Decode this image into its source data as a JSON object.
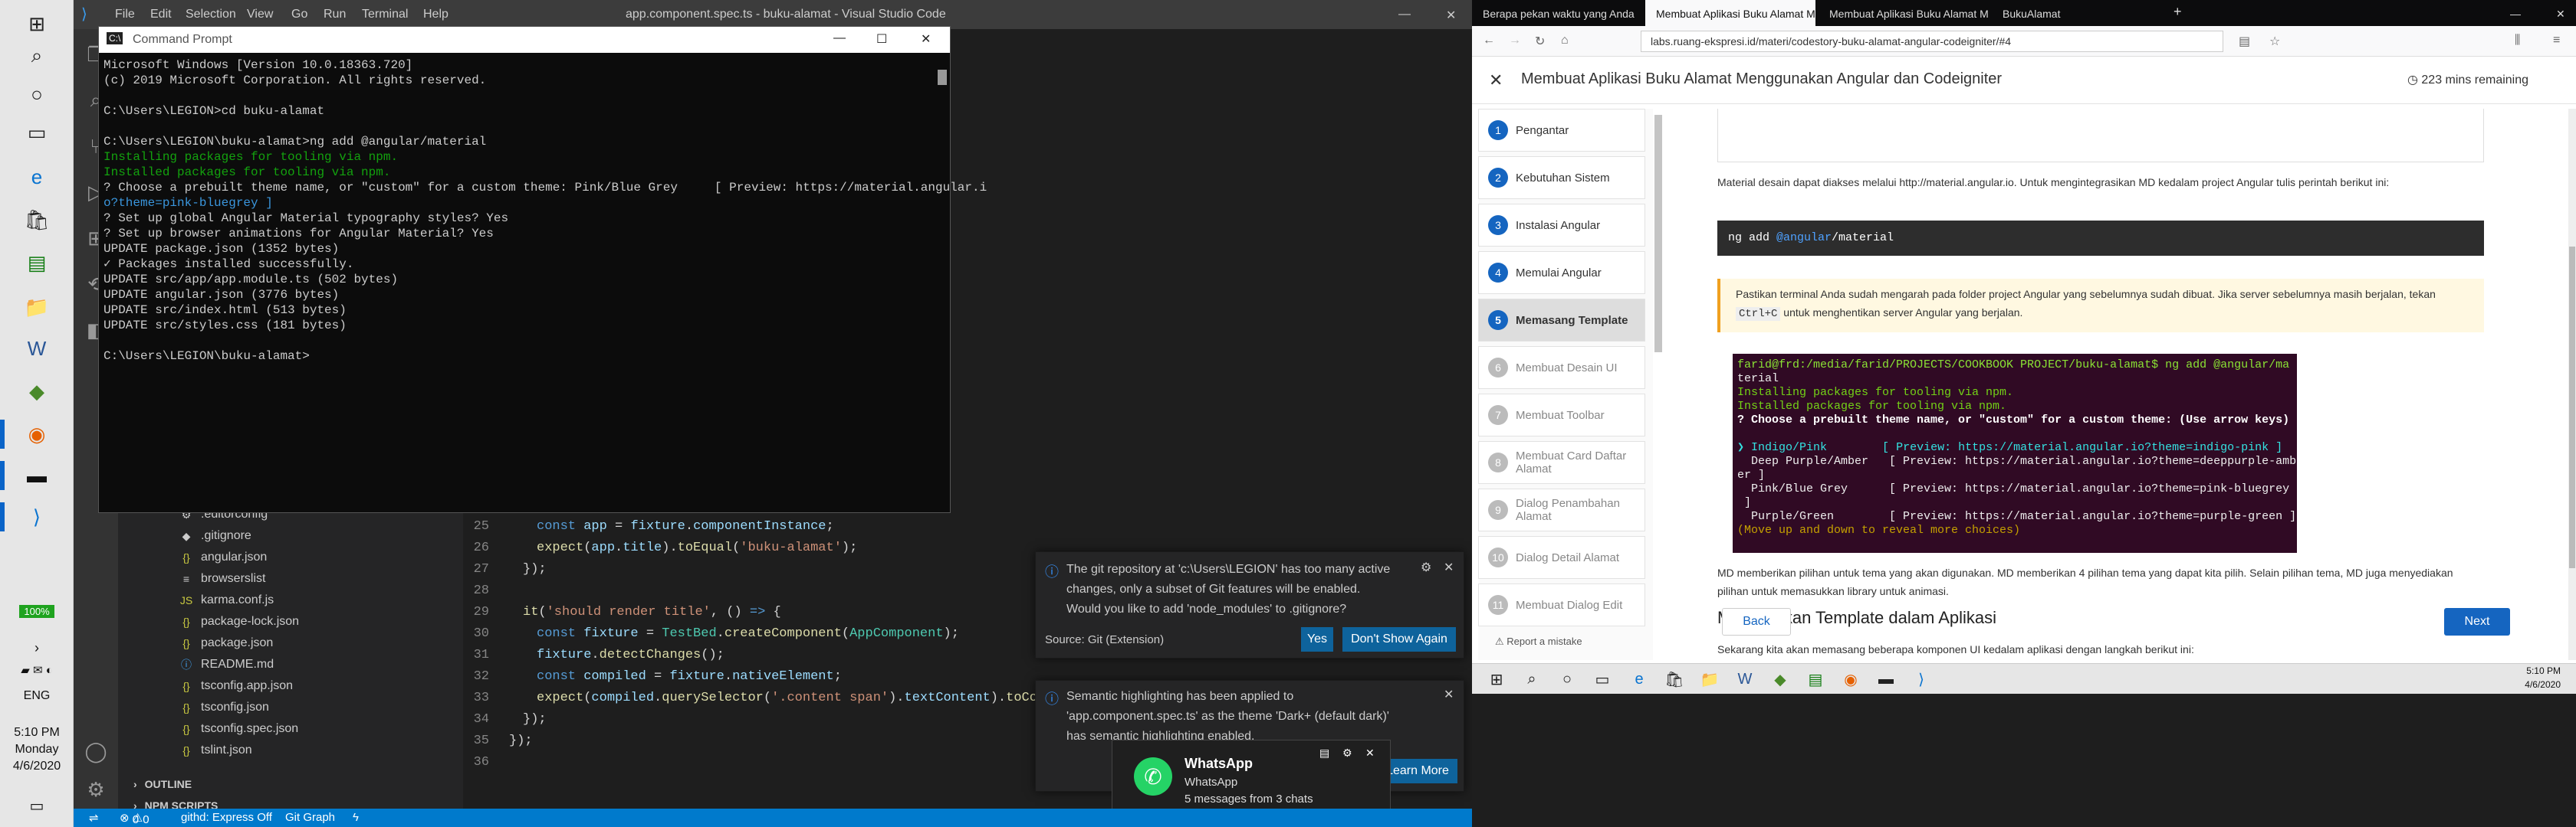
{
  "taskbar_left": {
    "battery": "100%",
    "lang": "ENG",
    "time": "5:10 PM",
    "day": "Monday",
    "date": "4/6/2020"
  },
  "vscode": {
    "menus": [
      "File",
      "Edit",
      "Selection",
      "View",
      "Go",
      "Run",
      "Terminal",
      "Help"
    ],
    "title": "app.component.spec.ts - buku-alamat - Visual Studio Code",
    "files": [
      ".editorconfig",
      ".gitignore",
      "angular.json",
      "browserslist",
      "karma.conf.js",
      "package-lock.json",
      "package.json",
      "README.md",
      "tsconfig.app.json",
      "tsconfig.json",
      "tsconfig.spec.json",
      "tslint.json"
    ],
    "outline": "OUTLINE",
    "npm": "NPM SCRIPTS",
    "code": [
      {
        "n": "25",
        "t": "const app = fixture.componentInstance;"
      },
      {
        "n": "26",
        "t": "expect(app.title).toEqual('buku-alamat');"
      },
      {
        "n": "27",
        "t": "});"
      },
      {
        "n": "28",
        "t": ""
      },
      {
        "n": "29",
        "t": "it('should render title', () => {"
      },
      {
        "n": "30",
        "t": "const fixture = TestBed.createComponent(AppComponent);"
      },
      {
        "n": "31",
        "t": "fixture.detectChanges();"
      },
      {
        "n": "32",
        "t": "const compiled = fixture.nativeElement;"
      },
      {
        "n": "33",
        "t": "expect(compiled.querySelector('.content span').textContent).toContain('buku-alamat app is running!');"
      },
      {
        "n": "34",
        "t": "});"
      },
      {
        "n": "35",
        "t": "});"
      },
      {
        "n": "36",
        "t": ""
      }
    ],
    "status": {
      "branch": "githd: Express Off",
      "graph": "Git Graph",
      "errors": "0",
      "warnings": "0"
    }
  },
  "cmd": {
    "title": "Command Prompt",
    "lines": [
      {
        "c": "",
        "t": "Microsoft Windows [Version 10.0.18363.720]"
      },
      {
        "c": "",
        "t": "(c) 2019 Microsoft Corporation. All rights reserved."
      },
      {
        "c": "",
        "t": ""
      },
      {
        "c": "",
        "t": "C:\\Users\\LEGION>cd buku-alamat"
      },
      {
        "c": "",
        "t": ""
      },
      {
        "c": "",
        "t": "C:\\Users\\LEGION\\buku-alamat>ng add @angular/material"
      },
      {
        "c": "g",
        "t": "Installing packages for tooling via npm."
      },
      {
        "c": "g",
        "t": "Installed packages for tooling via npm."
      },
      {
        "c": "",
        "t": "? Choose a prebuilt theme name, or \"custom\" for a custom theme: Pink/Blue Grey     [ Preview: https://material.angular.i"
      },
      {
        "c": "c",
        "t": "o?theme=pink-bluegrey ]"
      },
      {
        "c": "",
        "t": "? Set up global Angular Material typography styles? Yes"
      },
      {
        "c": "",
        "t": "? Set up browser animations for Angular Material? Yes"
      },
      {
        "c": "",
        "t": "UPDATE package.json (1352 bytes)"
      },
      {
        "c": "",
        "t": "✓ Packages installed successfully."
      },
      {
        "c": "",
        "t": "UPDATE src/app/app.module.ts (502 bytes)"
      },
      {
        "c": "",
        "t": "UPDATE angular.json (3776 bytes)"
      },
      {
        "c": "",
        "t": "UPDATE src/index.html (513 bytes)"
      },
      {
        "c": "",
        "t": "UPDATE src/styles.css (181 bytes)"
      },
      {
        "c": "",
        "t": ""
      },
      {
        "c": "",
        "t": "C:\\Users\\LEGION\\buku-alamat>"
      }
    ]
  },
  "notif_git": {
    "text": "The git repository at 'c:\\Users\\LEGION' has too many active changes, only a subset of Git features will be enabled. Would you like to add 'node_modules' to .gitignore?",
    "source": "Source: Git (Extension)",
    "yes": "Yes",
    "dont": "Don't Show Again"
  },
  "notif_sem": {
    "text": "Semantic highlighting has been applied to 'app.component.spec.ts' as the theme 'Dark+ (default dark)' has semantic highlighting enabled.",
    "learn": "Learn More"
  },
  "whatsapp": {
    "title": "WhatsApp",
    "sub": "WhatsApp",
    "msg": "5 messages from 3 chats"
  },
  "browser": {
    "tabs": [
      "Berapa pekan waktu yang Anda",
      "Membuat Aplikasi Buku Alamat M",
      "Membuat Aplikasi Buku Alamat M",
      "BukuAlamat"
    ],
    "url": "labs.ruang-ekspresi.id/materi/codestory-buku-alamat-angular-codeigniter/#4",
    "course_title": "Membuat Aplikasi Buku Alamat Menggunakan Angular dan Codeigniter",
    "time_left": "223 mins remaining",
    "steps": [
      {
        "n": "1",
        "label": "Pengantar"
      },
      {
        "n": "2",
        "label": "Kebutuhan Sistem"
      },
      {
        "n": "3",
        "label": "Instalasi Angular"
      },
      {
        "n": "4",
        "label": "Memulai Angular"
      },
      {
        "n": "5",
        "label": "Memasang Template"
      },
      {
        "n": "6",
        "label": "Membuat Desain UI"
      },
      {
        "n": "7",
        "label": "Membuat Toolbar"
      },
      {
        "n": "8",
        "label": "Membuat Card Daftar Alamat"
      },
      {
        "n": "9",
        "label": "Dialog Penambahan Alamat"
      },
      {
        "n": "10",
        "label": "Dialog Detail Alamat"
      },
      {
        "n": "11",
        "label": "Membuat Dialog Edit"
      }
    ],
    "report": "Report a mistake",
    "p1": "Material desain dapat diakses melalui http://material.angular.io. Untuk mengintegrasikan MD kedalam project Angular tulis perintah berikut ini:",
    "cmd1a": "ng add ",
    "cmd1b": "@angular",
    "cmd1c": "/material",
    "note_a": "Pastikan terminal Anda sudah mengarah pada folder project Angular yang sebelumnya sudah dibuat. Jika server sebelumnya masih berjalan, tekan ",
    "note_key": "Ctrl+C",
    "note_b": " untuk menghentikan server Angular yang berjalan.",
    "term": [
      {
        "c": "p",
        "t": "farid@frd:/media/farid/PROJECTS/COOKBOOK PROJECT/buku-alamat$ ng add @angular/ma"
      },
      {
        "c": "",
        "t": "terial"
      },
      {
        "c": "g",
        "t": "Installing packages for tooling via npm."
      },
      {
        "c": "g",
        "t": "Installed packages for tooling via npm."
      },
      {
        "c": "b",
        "t": "? Choose a prebuilt theme name, or \"custom\" for a custom theme: (Use arrow keys)"
      },
      {
        "c": "",
        "t": ""
      },
      {
        "c": "c",
        "t": "❯ Indigo/Pink        [ Preview: https://material.angular.io?theme=indigo-pink ]"
      },
      {
        "c": "",
        "t": "  Deep Purple/Amber   [ Preview: https://material.angular.io?theme=deeppurple-amb"
      },
      {
        "c": "",
        "t": "er ]"
      },
      {
        "c": "",
        "t": "  Pink/Blue Grey      [ Preview: https://material.angular.io?theme=pink-bluegrey"
      },
      {
        "c": "",
        "t": " ]"
      },
      {
        "c": "",
        "t": "  Purple/Green        [ Preview: https://material.angular.io?theme=purple-green ]"
      },
      {
        "c": "y",
        "t": "(Move up and down to reveal more choices)"
      }
    ],
    "p2": "MD memberikan pilihan untuk tema yang akan digunakan. MD memberikan 4 pilihan tema yang dapat kita pilih. Selain pilihan tema, MD juga menyediakan pilihan untuk memasukkan library untuk animasi.",
    "h2": "Menerapkan Template dalam Aplikasi",
    "p3": "Sekarang kita akan memasang beberapa komponen UI kedalam aplikasi dengan langkah berikut ini:",
    "back": "Back",
    "next": "Next"
  },
  "taskbar_right": {
    "time": "5:10 PM",
    "date": "4/6/2020"
  }
}
